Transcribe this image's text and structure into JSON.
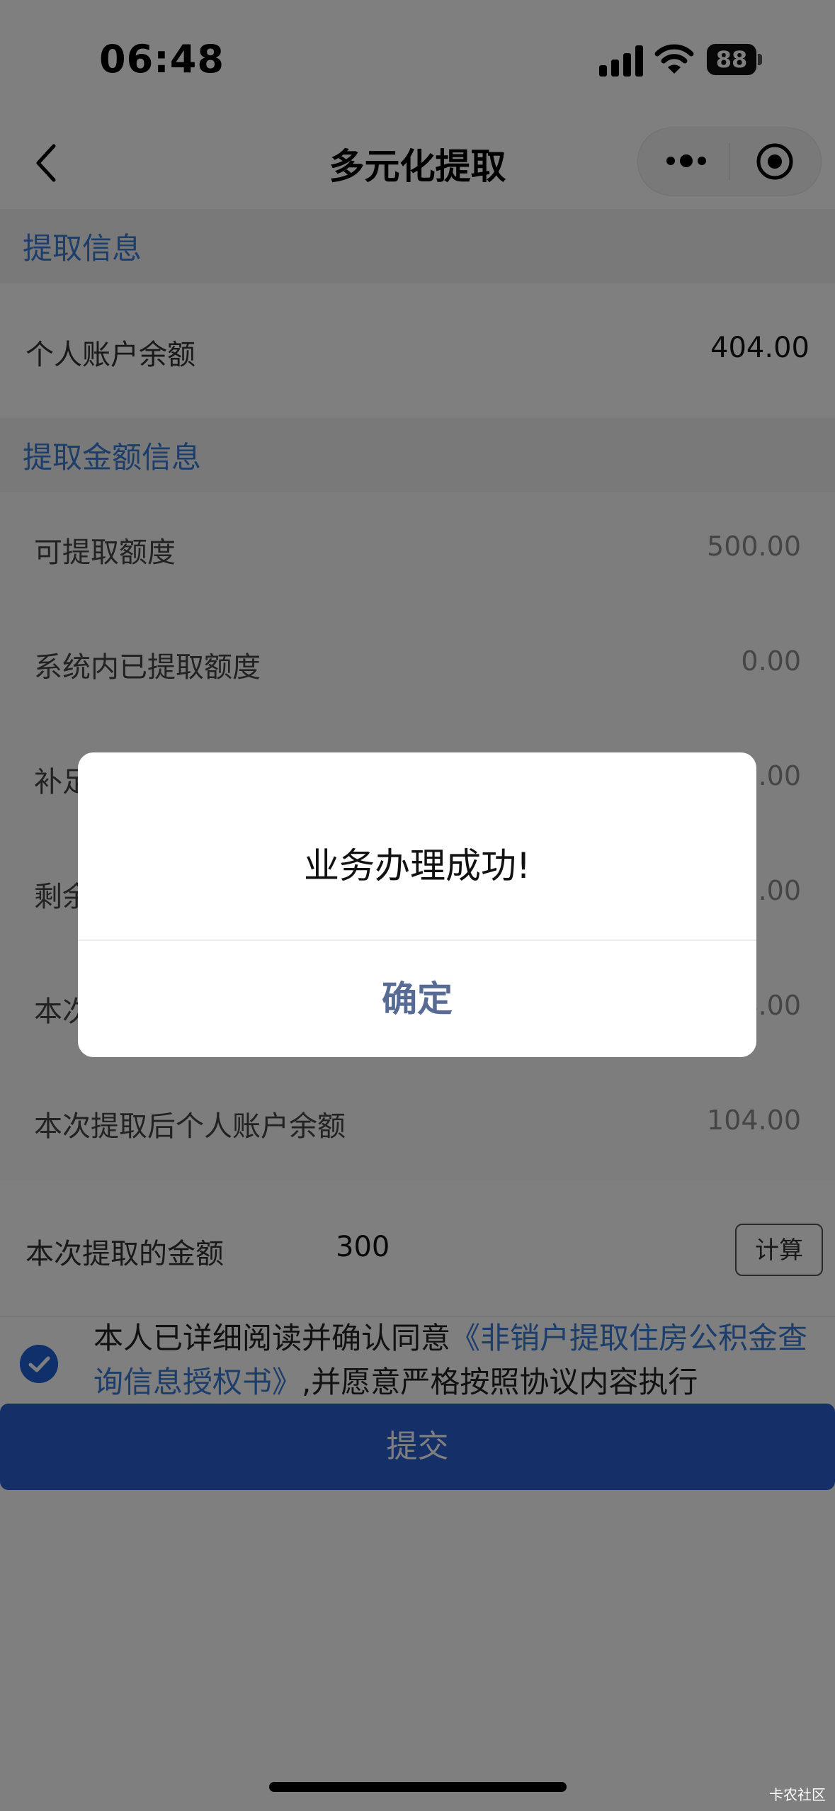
{
  "status": {
    "time": "06:48",
    "battery": "88"
  },
  "nav": {
    "title": "多元化提取"
  },
  "section1": {
    "title": "提取信息"
  },
  "balance": {
    "label": "个人账户余额",
    "value": "404.00"
  },
  "section2": {
    "title": "提取金额信息"
  },
  "rows": [
    {
      "label": "可提取额度",
      "value": "500.00"
    },
    {
      "label": "系统内已提取额度",
      "value": "0.00"
    },
    {
      "label": "补足",
      "value": "0.00"
    },
    {
      "label": "剩余",
      "value": "0.00"
    },
    {
      "label": "本次",
      "value": "4.00"
    },
    {
      "label": "本次提取后个人账户余额",
      "value": "104.00"
    }
  ],
  "amount": {
    "label": "本次提取的金额",
    "value": "300",
    "calc_label": "计算"
  },
  "agreement": {
    "prefix": "本人已详细阅读并确认同意",
    "link": "《非销户提取住房公积金查询信息授权书》",
    "suffix": ",并愿意严格按照协议内容执行",
    "checked": true
  },
  "submit": {
    "label": "提交"
  },
  "dialog": {
    "message": "业务办理成功!",
    "confirm": "确定"
  },
  "watermark": "卡农社区",
  "colors": {
    "accent": "#3a7bd5",
    "primary_button": "#2b5fd3",
    "dialog_button": "#576b95"
  }
}
